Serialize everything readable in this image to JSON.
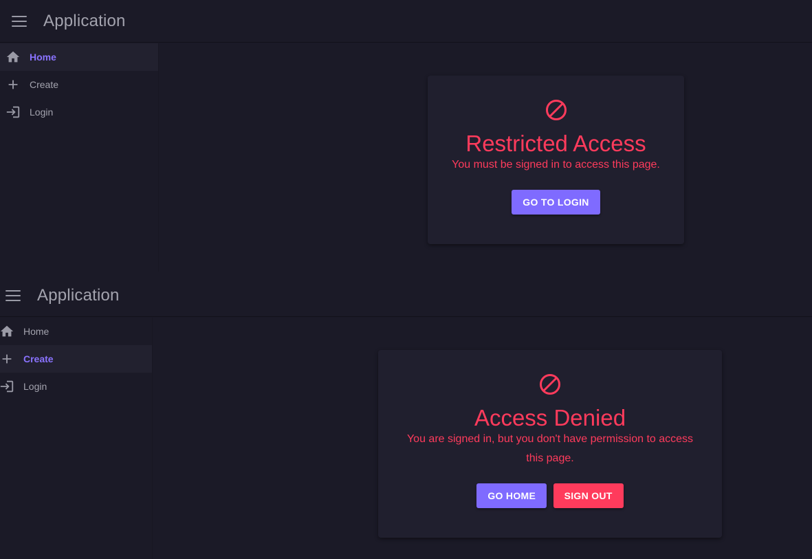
{
  "colors": {
    "background": "#1b1a27",
    "card": "#201f2e",
    "accent": "#7f6bff",
    "error": "#ff3b5c",
    "muted_text": "#a3a3ae"
  },
  "views": [
    {
      "app_title": "Application",
      "nav": [
        {
          "label": "Home",
          "icon": "home-icon",
          "active": true
        },
        {
          "label": "Create",
          "icon": "plus-icon",
          "active": false
        },
        {
          "label": "Login",
          "icon": "login-icon",
          "active": false
        }
      ],
      "card": {
        "icon": "block-icon",
        "title": "Restricted Access",
        "message": "You must be signed in to access this page.",
        "buttons": [
          {
            "label": "GO TO LOGIN",
            "style": "primary"
          }
        ]
      }
    },
    {
      "app_title": "Application",
      "nav": [
        {
          "label": "Home",
          "icon": "home-icon",
          "active": false
        },
        {
          "label": "Create",
          "icon": "plus-icon",
          "active": true
        },
        {
          "label": "Login",
          "icon": "login-icon",
          "active": false
        }
      ],
      "card": {
        "icon": "block-icon",
        "title": "Access Denied",
        "message_line1": "You are signed in, but you don't have permission to access",
        "message_line2": "this page.",
        "buttons": [
          {
            "label": "GO HOME",
            "style": "primary"
          },
          {
            "label": "SIGN OUT",
            "style": "danger"
          }
        ]
      }
    }
  ]
}
